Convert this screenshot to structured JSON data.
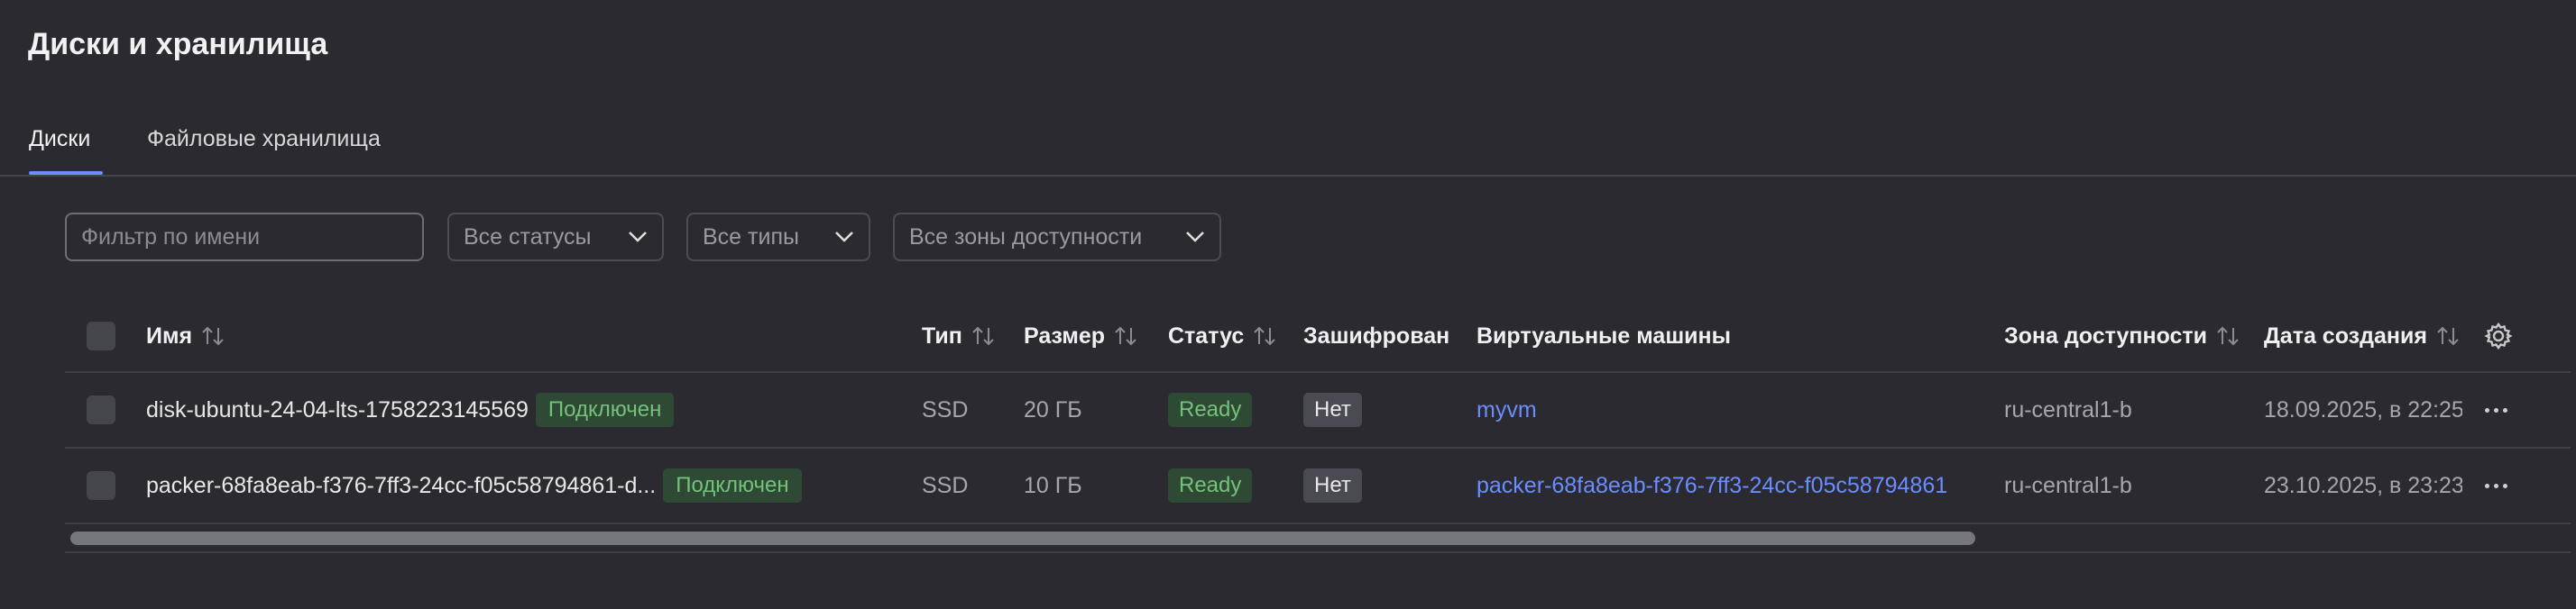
{
  "page": {
    "title": "Диски и хранилища"
  },
  "tabs": [
    {
      "label": "Диски",
      "active": true
    },
    {
      "label": "Файловые хранилища",
      "active": false
    }
  ],
  "filters": {
    "name_placeholder": "Фильтр по имени",
    "status_select": "Все статусы",
    "type_select": "Все типы",
    "zone_select": "Все зоны доступности"
  },
  "table": {
    "headers": {
      "name": "Имя",
      "type": "Тип",
      "size": "Размер",
      "status": "Статус",
      "encrypted": "Зашифрован",
      "vms": "Виртуальные машины",
      "zone": "Зона доступности",
      "created": "Дата создания"
    },
    "rows": [
      {
        "name": "disk-ubuntu-24-04-lts-1758223145569",
        "attach_badge": "Подключен",
        "type": "SSD",
        "size": "20 ГБ",
        "status": "Ready",
        "encrypted": "Нет",
        "vm": "myvm",
        "zone": "ru-central1-b",
        "created": "18.09.2025, в 22:25"
      },
      {
        "name": "packer-68fa8eab-f376-7ff3-24cc-f05c58794861-d...",
        "attach_badge": "Подключен",
        "type": "SSD",
        "size": "10 ГБ",
        "status": "Ready",
        "encrypted": "Нет",
        "vm": "packer-68fa8eab-f376-7ff3-24cc-f05c58794861",
        "zone": "ru-central1-b",
        "created": "23.10.2025, в 23:23"
      }
    ]
  },
  "colors": {
    "background": "#2a2a30",
    "accent": "#6a8dff",
    "success_text": "#74c27a",
    "success_bg": "#2f4a34"
  },
  "icons": {
    "sort": "sort-arrows-icon",
    "chevron": "chevron-down-icon",
    "settings": "gear-icon",
    "actions": "more-horizontal-icon"
  }
}
